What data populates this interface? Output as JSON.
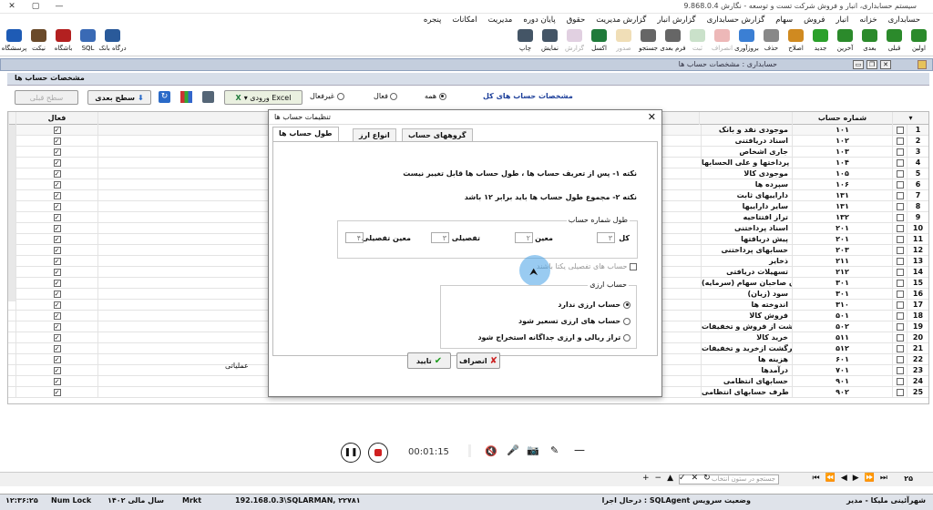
{
  "window": {
    "title": "سیستم حسابداری، انبار و فروش شرکت تست و توسعه - نگارش 9.868.0.4"
  },
  "menu": [
    "حسابداری",
    "خزانه",
    "انبار",
    "فروش",
    "سهام",
    "گزارش حسابداری",
    "گزارش انبار",
    "گزارش مدیریت",
    "حقوق",
    "پایان دوره",
    "مدیریت",
    "امکانات",
    "پنجره"
  ],
  "toolbar_left": [
    {
      "label": "پرسشگاه",
      "icon": "help-icon",
      "color": "#1e5bb5"
    },
    {
      "label": "نیکت",
      "icon": "ticket-icon",
      "color": "#6a4a2a"
    },
    {
      "label": "باشگاه",
      "icon": "club-icon",
      "color": "#b32020"
    },
    {
      "label": "SQL",
      "icon": "sql-icon",
      "color": "#3a6ab5"
    },
    {
      "label": "درگاه بانک",
      "icon": "bank-icon",
      "color": "#2a5a9a"
    }
  ],
  "toolbar_right": [
    {
      "label": "اولین",
      "icon": "first-icon",
      "color": "#2b8a2b",
      "on": true
    },
    {
      "label": "قبلی",
      "icon": "prev-icon",
      "color": "#2b8a2b",
      "on": true
    },
    {
      "label": "بعدی",
      "icon": "next-icon",
      "color": "#2b8a2b",
      "on": true
    },
    {
      "label": "آخرین",
      "icon": "last-icon",
      "color": "#2b8a2b",
      "on": true
    },
    {
      "label": "جدید",
      "icon": "new-icon",
      "color": "#2aa02a",
      "on": true
    },
    {
      "label": "اصلاح",
      "icon": "edit-icon",
      "color": "#d08a20",
      "on": true
    },
    {
      "label": "حذف",
      "icon": "delete-icon",
      "color": "#888",
      "on": true
    },
    {
      "label": "بروزآوری",
      "icon": "refresh-icon",
      "color": "#3b7fd4",
      "on": true
    },
    {
      "label": "انصراف",
      "icon": "cancel-icon",
      "color": "#c33",
      "on": false
    },
    {
      "label": "ثبت",
      "icon": "save-icon",
      "color": "#6a6",
      "on": false
    },
    {
      "label": "فرم بعدی",
      "icon": "next-form-icon",
      "color": "#666",
      "on": true
    },
    {
      "label": "جستجو",
      "icon": "search-icon",
      "color": "#666",
      "on": true
    },
    {
      "label": "صدور",
      "icon": "export-icon",
      "color": "#d4a030",
      "on": false
    },
    {
      "label": "اکسل",
      "icon": "excel-icon",
      "color": "#1f7a3a",
      "on": true
    },
    {
      "label": "گزارش",
      "icon": "report-icon",
      "color": "#a7a",
      "on": false
    },
    {
      "label": "نمایش",
      "icon": "view-icon",
      "color": "#456",
      "on": true
    },
    {
      "label": "چاپ",
      "icon": "print-icon",
      "color": "#456",
      "on": true
    }
  ],
  "panel": {
    "title": "حسابداری : مشخصات حساب ها",
    "tab": "مشخصات حساب ها"
  },
  "options": {
    "heading": "مشخصات حساب های کل",
    "all": "همه",
    "active": "فعال",
    "inactive": "غیرفعال",
    "import": "▾ ورودی Excel",
    "next_level": "سطح بعدی",
    "prev_level": "سطح قبلی"
  },
  "grid": {
    "col_number": "شماره حساب",
    "col_group": "نام گروه",
    "col_active": "فعال",
    "note_cut": "عملیاتی",
    "rows": [
      [
        "1",
        "۱۰۱",
        "موجودی نقد و بانک"
      ],
      [
        "2",
        "۱۰۲",
        "اسناد دریافتنی"
      ],
      [
        "3",
        "۱۰۳",
        "جاری اشخاص"
      ],
      [
        "4",
        "۱۰۴",
        "پیش پرداختها و علی الحسابها"
      ],
      [
        "5",
        "۱۰۵",
        "موجودی کالا"
      ],
      [
        "6",
        "۱۰۶",
        "سپرده ها"
      ],
      [
        "7",
        "۱۳۱",
        "داراییهای ثابت"
      ],
      [
        "8",
        "۱۳۱",
        "سایر داراییها"
      ],
      [
        "9",
        "۱۳۲",
        "تراز افتتاحیه"
      ],
      [
        "10",
        "۲۰۱",
        "اسناد پرداختنی"
      ],
      [
        "11",
        "۲۰۱",
        "پیش دریافتها"
      ],
      [
        "12",
        "۲۰۳",
        "حسابهای پرداختنی"
      ],
      [
        "13",
        "۲۱۱",
        "ذخایر"
      ],
      [
        "14",
        "۲۱۲",
        "تسهیلات دریافتی"
      ],
      [
        "15",
        "۳۰۱",
        "حقوق صاحبان سهام (سرمایه)"
      ],
      [
        "16",
        "۳۰۱",
        "سود (زیان)"
      ],
      [
        "17",
        "۳۱۰",
        "اندوخته ها"
      ],
      [
        "18",
        "۵۰۱",
        "فروش کالا"
      ],
      [
        "19",
        "۵۰۲",
        "برگشت از فروش و تخفیفات"
      ],
      [
        "20",
        "۵۱۱",
        "خرید کالا"
      ],
      [
        "21",
        "۵۱۲",
        "برگشت ازخرید و تخفیفات"
      ],
      [
        "22",
        "۶۰۱",
        "هزینه ها"
      ],
      [
        "23",
        "۷۰۱",
        "درآمدها"
      ],
      [
        "24",
        "۹۰۱",
        "حسابهای انتظامی"
      ],
      [
        "25",
        "۹۰۲",
        "طرف حسابهای انتظامی"
      ]
    ]
  },
  "dialog": {
    "title": "تنظیمات حساب ها",
    "tabs": [
      "طول حساب ها",
      "انواع ارز",
      "گروههای حساب"
    ],
    "note1": "نکته ۱- پس از تعریف حساب ها ، طول حساب ها قابل تغییر نیست",
    "note2": "نکته ۲- مجموع طول حساب ها باید برابر ۱۲ باشد",
    "length_group": "طول شماره حساب",
    "kol": "کل",
    "moein": "معین",
    "tafsili": "تفصیلی",
    "moein_tafsili": "معین تفصیلی",
    "kol_val": "۳",
    "moein_val": "۲",
    "tafsili_val": "۳",
    "mt_val": "۴",
    "unique_check": "حساب های تفصیلی یکتا باشند",
    "currency_group": "حساب ارزی",
    "cur1": "حساب ارزی ندارد",
    "cur2": "حساب های ارزی تسعیر شود",
    "cur3": "تراز ریالی و ارزی جداگانه استخراج شود",
    "ok": "تایید",
    "cancel": "انصراف"
  },
  "media": {
    "time": "00:01:15"
  },
  "nav": {
    "count": "۲۵",
    "search_placeholder": "جستجو در ستون انتخاب"
  },
  "status": {
    "time": "۱۲:۳۶:۲۵",
    "numlock": "Num Lock",
    "year": "سال مالی ۱۴۰۲",
    "mode": "Mrkt",
    "server": "192.168.0.3\\SQLARMAN, ۲۲۷۸۱",
    "agent": "درحال اجرا : SQLAgent وضعیت سرویس",
    "user": "شهرآئینی ملیکا - مدیر"
  }
}
